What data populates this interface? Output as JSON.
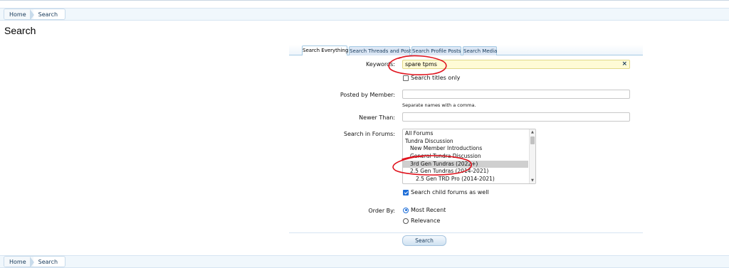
{
  "breadcrumb": {
    "home": "Home",
    "current": "Search"
  },
  "page_title": "Search",
  "tabs": [
    {
      "label": "Search Everything",
      "active": true
    },
    {
      "label": "Search Threads and Posts",
      "active": false
    },
    {
      "label": "Search Profile Posts",
      "active": false
    },
    {
      "label": "Search Media",
      "active": false
    }
  ],
  "form": {
    "keywords_label": "Keywords:",
    "keywords_value": "spare tpms",
    "keywords_clear": "×",
    "titles_only_label": "Search titles only",
    "titles_only_checked": false,
    "posted_by_label": "Posted by Member:",
    "posted_by_value": "",
    "posted_by_hint": "Separate names with a comma.",
    "newer_than_label": "Newer Than:",
    "newer_than_value": "",
    "forums_label": "Search in Forums:",
    "forums": [
      {
        "label": "All Forums",
        "indent": 0,
        "selected": false
      },
      {
        "label": "Tundra Discussion",
        "indent": 0,
        "selected": false
      },
      {
        "label": "New Member Introductions",
        "indent": 1,
        "selected": false
      },
      {
        "label": "General Tundra Discussion",
        "indent": 1,
        "selected": false
      },
      {
        "label": "3rd Gen Tundras (2022+)",
        "indent": 1,
        "selected": true
      },
      {
        "label": "2.5 Gen Tundras (2014-2021)",
        "indent": 1,
        "selected": false
      },
      {
        "label": "2.5 Gen TRD Pro (2014-2021)",
        "indent": 2,
        "selected": false
      }
    ],
    "child_forums_label": "Search child forums as well",
    "child_forums_checked": true,
    "order_by_label": "Order By:",
    "order_options": [
      {
        "label": "Most Recent",
        "checked": true
      },
      {
        "label": "Relevance",
        "checked": false
      }
    ],
    "submit_label": "Search"
  },
  "colors": {
    "accent": "#1f6fd8",
    "link": "#16395a",
    "annotation": "#e0141e"
  },
  "annotations": {
    "type": "red hand-drawn circles around keywords field and selected forum"
  }
}
